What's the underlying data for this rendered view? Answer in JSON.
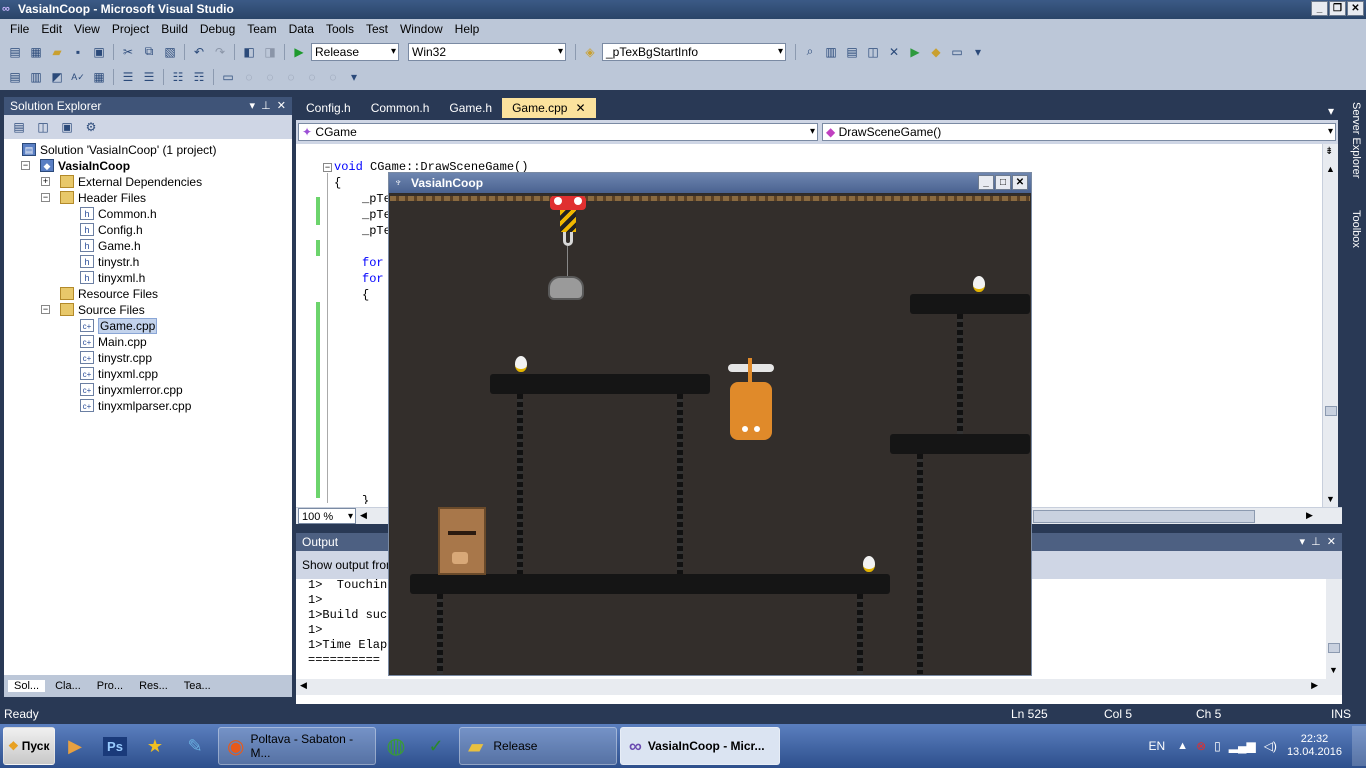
{
  "window": {
    "title": "VasiaInCoop - Microsoft Visual Studio"
  },
  "menu": [
    "File",
    "Edit",
    "View",
    "Project",
    "Build",
    "Debug",
    "Team",
    "Data",
    "Tools",
    "Test",
    "Window",
    "Help"
  ],
  "toolbar": {
    "config": "Release",
    "platform": "Win32",
    "find_combo": "_pTexBgStartInfo"
  },
  "solution_explorer": {
    "title": "Solution Explorer",
    "tree": [
      {
        "label": "Solution 'VasiaInCoop' (1 project)",
        "indent": 0,
        "icon": "solution"
      },
      {
        "label": "VasiaInCoop",
        "indent": 1,
        "icon": "project",
        "bold": true,
        "expander": "−"
      },
      {
        "label": "External Dependencies",
        "indent": 2,
        "icon": "folder",
        "expander": "+"
      },
      {
        "label": "Header Files",
        "indent": 2,
        "icon": "folder",
        "expander": "−"
      },
      {
        "label": "Common.h",
        "indent": 3,
        "icon": "h"
      },
      {
        "label": "Config.h",
        "indent": 3,
        "icon": "h"
      },
      {
        "label": "Game.h",
        "indent": 3,
        "icon": "h"
      },
      {
        "label": "tinystr.h",
        "indent": 3,
        "icon": "h"
      },
      {
        "label": "tinyxml.h",
        "indent": 3,
        "icon": "h"
      },
      {
        "label": "Resource Files",
        "indent": 2,
        "icon": "folder"
      },
      {
        "label": "Source Files",
        "indent": 2,
        "icon": "folder",
        "expander": "−"
      },
      {
        "label": "Game.cpp",
        "indent": 3,
        "icon": "cpp",
        "selected": true
      },
      {
        "label": "Main.cpp",
        "indent": 3,
        "icon": "cpp"
      },
      {
        "label": "tinystr.cpp",
        "indent": 3,
        "icon": "cpp"
      },
      {
        "label": "tinyxml.cpp",
        "indent": 3,
        "icon": "cpp"
      },
      {
        "label": "tinyxmlerror.cpp",
        "indent": 3,
        "icon": "cpp"
      },
      {
        "label": "tinyxmlparser.cpp",
        "indent": 3,
        "icon": "cpp"
      }
    ],
    "tabs": [
      "Sol...",
      "Cla...",
      "Pro...",
      "Res...",
      "Tea..."
    ]
  },
  "doc_tabs": [
    "Config.h",
    "Common.h",
    "Game.h",
    "Game.cpp"
  ],
  "nav": {
    "class_combo": "CGame",
    "member_combo": "DrawSceneGame()"
  },
  "code": {
    "line1_kw": "void",
    "line1": " CGame::DrawSceneGame()",
    "line2": "{",
    "line3": "_pTe",
    "line4": "_pTe",
    "line5": "_pTe",
    "line6_kw": "for",
    "line7_kw": "for",
    "line8": "{",
    "line9": "}"
  },
  "zoom": "100 %",
  "game_window": {
    "title": "VasiaInCoop"
  },
  "output": {
    "title": "Output",
    "show_from": "Show output from",
    "lines": [
      "1>  Touchin",
      "1>",
      "1>Build suc",
      "1>",
      "1>Time Elap",
      "=========="
    ]
  },
  "right_strip": {
    "server_explorer": "Server Explorer",
    "toolbox": "Toolbox"
  },
  "status": {
    "left": "Ready",
    "ln": "Ln 525",
    "col": "Col 5",
    "ch": "Ch 5",
    "mode": "INS"
  },
  "taskbar": {
    "start": "Пуск",
    "tasks": [
      "Poltava - Sabaton - M...",
      "Release",
      "VasiaInCoop - Micr..."
    ],
    "lang": "EN",
    "time": "22:32",
    "date": "13.04.2016"
  }
}
